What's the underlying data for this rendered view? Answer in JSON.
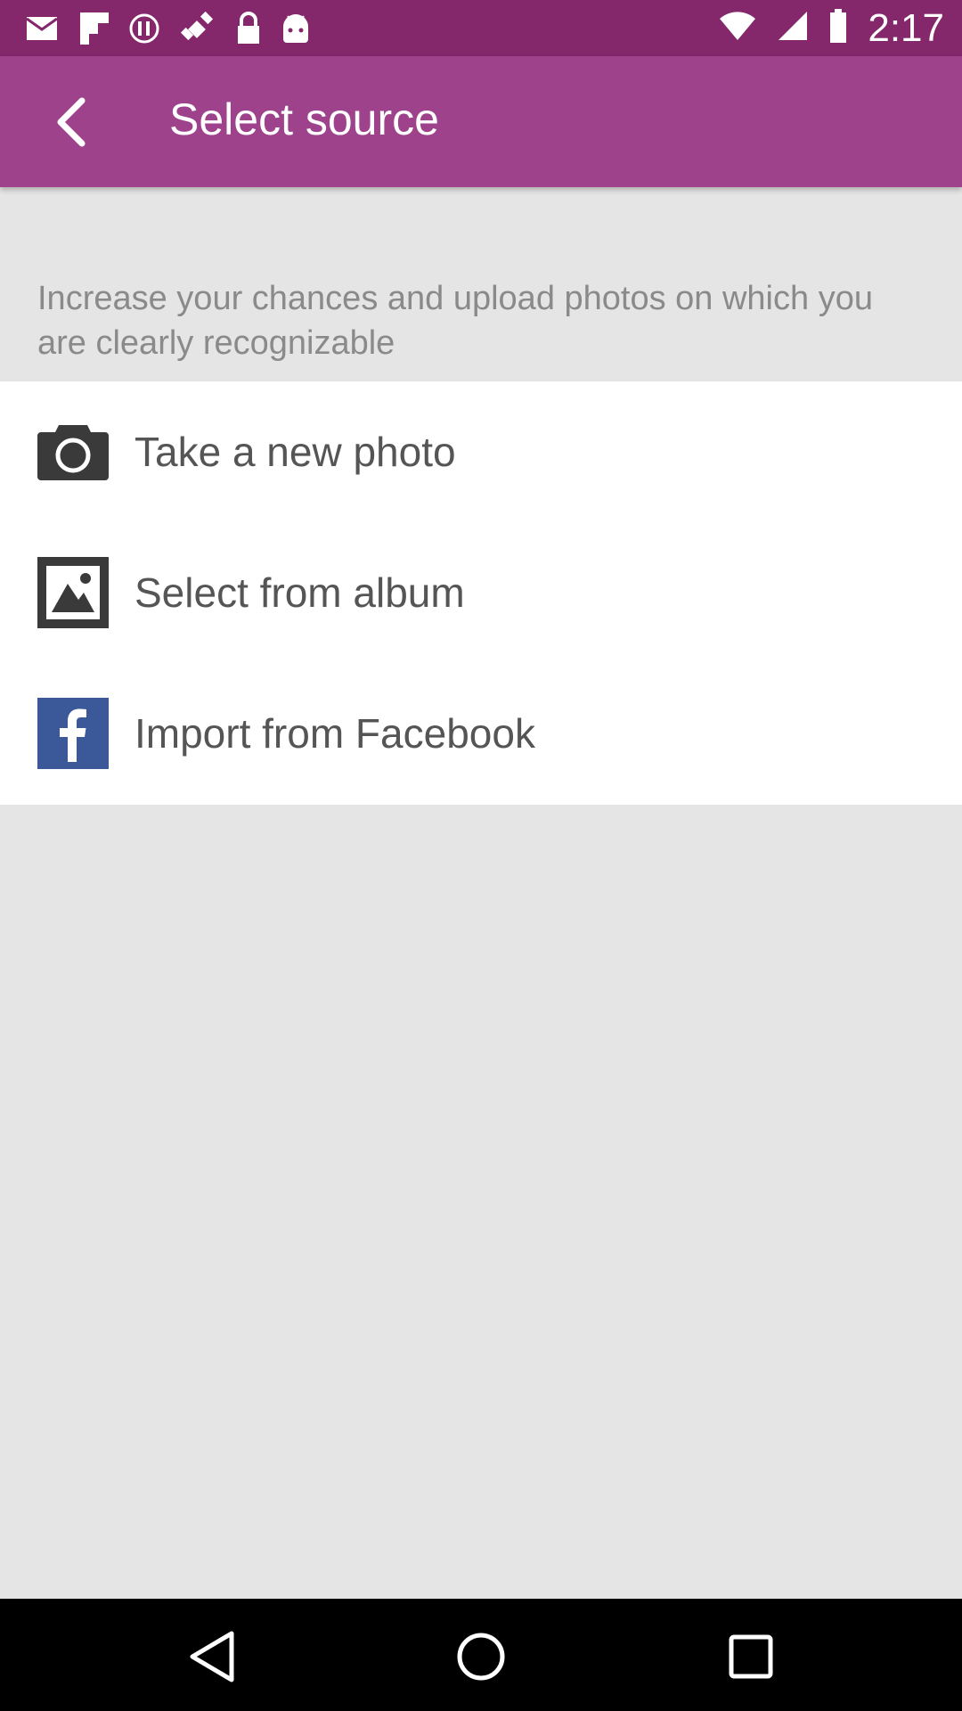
{
  "status_bar": {
    "time": "2:17",
    "icons": [
      "mail-icon",
      "flipboard-icon",
      "alert-icon",
      "fake-gps-icon",
      "lock-icon",
      "android-icon",
      "wifi-icon",
      "signal-icon",
      "battery-icon"
    ]
  },
  "header": {
    "title": "Select source",
    "back_icon": "back-arrow-icon"
  },
  "hint": "Increase your chances and upload photos on which you are clearly recognizable",
  "options": [
    {
      "label": "Take a new photo",
      "icon": "camera-icon"
    },
    {
      "label": "Select from album",
      "icon": "album-icon"
    },
    {
      "label": "Import from Facebook",
      "icon": "facebook-icon"
    }
  ],
  "nav": [
    "back-nav-icon",
    "home-nav-icon",
    "recents-nav-icon"
  ],
  "colors": {
    "status_bar": "#84276b",
    "app_bar": "#9d428b",
    "background": "#e6e5e6",
    "facebook": "#3b5998"
  }
}
